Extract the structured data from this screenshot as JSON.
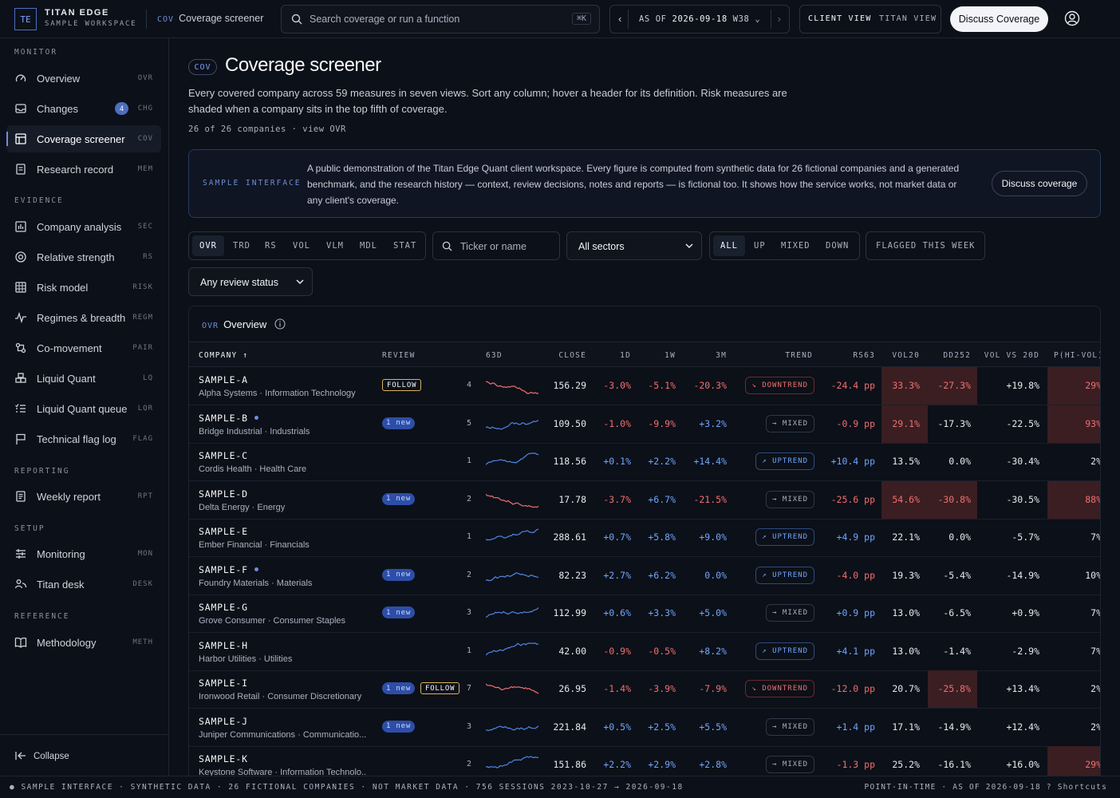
{
  "header": {
    "logo": "TE",
    "brand": "TITAN EDGE",
    "workspace": "SAMPLE WORKSPACE",
    "crumb_code": "COV",
    "crumb_label": "Coverage screener",
    "search_placeholder": "Search coverage or run a function",
    "search_shortcut": "⌘K",
    "asof_prefix": "AS OF",
    "asof_date": "2026-09-18",
    "asof_week": "W38",
    "view_client": "CLIENT VIEW",
    "view_titan": "TITAN VIEW",
    "cta": "Discuss Coverage"
  },
  "sidebar": {
    "sections": [
      {
        "title": "MONITOR",
        "items": [
          {
            "label": "Overview",
            "code": "OVR",
            "icon": "gauge-icon"
          },
          {
            "label": "Changes",
            "code": "CHG",
            "icon": "inbox-icon",
            "badge": "4"
          },
          {
            "label": "Coverage screener",
            "code": "COV",
            "icon": "table-icon",
            "active": true
          },
          {
            "label": "Research record",
            "code": "MEM",
            "icon": "document-icon"
          }
        ]
      },
      {
        "title": "EVIDENCE",
        "items": [
          {
            "label": "Company analysis",
            "code": "SEC",
            "icon": "bar-chart-icon"
          },
          {
            "label": "Relative strength",
            "code": "RS",
            "icon": "target-icon"
          },
          {
            "label": "Risk model",
            "code": "RISK",
            "icon": "grid-icon"
          },
          {
            "label": "Regimes & breadth",
            "code": "REGM",
            "icon": "pulse-icon"
          },
          {
            "label": "Co-movement",
            "code": "PAIR",
            "icon": "link-icon"
          },
          {
            "label": "Liquid Quant",
            "code": "LQ",
            "icon": "cubes-icon"
          },
          {
            "label": "Liquid Quant queue",
            "code": "LQR",
            "icon": "list-check-icon"
          },
          {
            "label": "Technical flag log",
            "code": "FLAG",
            "icon": "flag-icon"
          }
        ]
      },
      {
        "title": "REPORTING",
        "items": [
          {
            "label": "Weekly report",
            "code": "RPT",
            "icon": "report-icon"
          }
        ]
      },
      {
        "title": "SETUP",
        "items": [
          {
            "label": "Monitoring",
            "code": "MON",
            "icon": "sliders-icon"
          },
          {
            "label": "Titan desk",
            "code": "DESK",
            "icon": "users-icon"
          }
        ]
      },
      {
        "title": "REFERENCE",
        "items": [
          {
            "label": "Methodology",
            "code": "METH",
            "icon": "book-icon"
          }
        ]
      }
    ],
    "collapse": "Collapse"
  },
  "page": {
    "code": "COV",
    "title": "Coverage screener",
    "description": "Every covered company across 59 measures in seven views. Sort any column; hover a header for its definition. Risk measures are shaded when a company sits in the top fifth of coverage.",
    "count": "26 of 26 companies · view OVR"
  },
  "banner": {
    "label": "SAMPLE INTERFACE",
    "text": "A public demonstration of the Titan Edge Quant client workspace. Every figure is computed from synthetic data for 26 fictional companies and a generated benchmark, and the research history — context, review decisions, notes and reports — is fictional too. It shows how the service works, not market data or any client's coverage.",
    "button": "Discuss coverage"
  },
  "filters": {
    "views": [
      "OVR",
      "TRD",
      "RS",
      "VOL",
      "VLM",
      "MDL",
      "STAT"
    ],
    "ticker_placeholder": "Ticker or name",
    "sector": "All sectors",
    "trend_filters": [
      "ALL",
      "UP",
      "MIXED",
      "DOWN"
    ],
    "flagged": "FLAGGED THIS WEEK",
    "review": "Any review status"
  },
  "table": {
    "code": "OVR",
    "title": "Overview",
    "columns": [
      "COMPANY ↑",
      "REVIEW",
      "63D",
      "CLOSE",
      "1D",
      "1W",
      "3M",
      "TREND",
      "RS63",
      "VOL20",
      "DD252",
      "VOL VS 20D",
      "P(HI-VOL)"
    ],
    "rows": [
      {
        "ticker": "SAMPLE-A",
        "dot": false,
        "sub": "Alpha Systems · Information Technology",
        "follow": true,
        "new": "",
        "n": "4",
        "close": "156.29",
        "d1": "-3.0%",
        "w1": "-5.1%",
        "m3": "-20.3%",
        "trend": "DOWNTREND",
        "rs": "-24.4 pp",
        "vol20": "33.3%",
        "dd": "-27.3%",
        "volvs": "+19.8%",
        "phv": "29%",
        "hv": true,
        "hd": true,
        "hp": true
      },
      {
        "ticker": "SAMPLE-B",
        "dot": true,
        "sub": "Bridge Industrial · Industrials",
        "follow": false,
        "new": "1 new",
        "n": "5",
        "close": "109.50",
        "d1": "-1.0%",
        "w1": "-9.9%",
        "m3": "+3.2%",
        "trend": "MIXED",
        "rs": "-0.9 pp",
        "vol20": "29.1%",
        "dd": "-17.3%",
        "volvs": "-22.5%",
        "phv": "93%",
        "hv": true,
        "hd": false,
        "hp": true
      },
      {
        "ticker": "SAMPLE-C",
        "dot": false,
        "sub": "Cordis Health · Health Care",
        "follow": false,
        "new": "",
        "n": "1",
        "close": "118.56",
        "d1": "+0.1%",
        "w1": "+2.2%",
        "m3": "+14.4%",
        "trend": "UPTREND",
        "rs": "+10.4 pp",
        "vol20": "13.5%",
        "dd": "0.0%",
        "volvs": "-30.4%",
        "phv": "2%",
        "hv": false,
        "hd": false,
        "hp": false
      },
      {
        "ticker": "SAMPLE-D",
        "dot": false,
        "sub": "Delta Energy · Energy",
        "follow": false,
        "new": "1 new",
        "n": "2",
        "close": "17.78",
        "d1": "-3.7%",
        "w1": "+6.7%",
        "m3": "-21.5%",
        "trend": "MIXED",
        "rs": "-25.6 pp",
        "vol20": "54.6%",
        "dd": "-30.8%",
        "volvs": "-30.5%",
        "phv": "88%",
        "hv": true,
        "hd": true,
        "hp": true
      },
      {
        "ticker": "SAMPLE-E",
        "dot": false,
        "sub": "Ember Financial · Financials",
        "follow": false,
        "new": "",
        "n": "1",
        "close": "288.61",
        "d1": "+0.7%",
        "w1": "+5.8%",
        "m3": "+9.0%",
        "trend": "UPTREND",
        "rs": "+4.9 pp",
        "vol20": "22.1%",
        "dd": "0.0%",
        "volvs": "-5.7%",
        "phv": "7%",
        "hv": false,
        "hd": false,
        "hp": false
      },
      {
        "ticker": "SAMPLE-F",
        "dot": true,
        "sub": "Foundry Materials · Materials",
        "follow": false,
        "new": "1 new",
        "n": "2",
        "close": "82.23",
        "d1": "+2.7%",
        "w1": "+6.2%",
        "m3": "0.0%",
        "trend": "UPTREND",
        "rs": "-4.0 pp",
        "vol20": "19.3%",
        "dd": "-5.4%",
        "volvs": "-14.9%",
        "phv": "10%",
        "hv": false,
        "hd": false,
        "hp": false
      },
      {
        "ticker": "SAMPLE-G",
        "dot": false,
        "sub": "Grove Consumer · Consumer Staples",
        "follow": false,
        "new": "1 new",
        "n": "3",
        "close": "112.99",
        "d1": "+0.6%",
        "w1": "+3.3%",
        "m3": "+5.0%",
        "trend": "MIXED",
        "rs": "+0.9 pp",
        "vol20": "13.0%",
        "dd": "-6.5%",
        "volvs": "+0.9%",
        "phv": "7%",
        "hv": false,
        "hd": false,
        "hp": false
      },
      {
        "ticker": "SAMPLE-H",
        "dot": false,
        "sub": "Harbor Utilities · Utilities",
        "follow": false,
        "new": "",
        "n": "1",
        "close": "42.00",
        "d1": "-0.9%",
        "w1": "-0.5%",
        "m3": "+8.2%",
        "trend": "UPTREND",
        "rs": "+4.1 pp",
        "vol20": "13.0%",
        "dd": "-1.4%",
        "volvs": "-2.9%",
        "phv": "7%",
        "hv": false,
        "hd": false,
        "hp": false
      },
      {
        "ticker": "SAMPLE-I",
        "dot": false,
        "sub": "Ironwood Retail · Consumer Discretionary",
        "follow": true,
        "new": "1 new",
        "n": "7",
        "close": "26.95",
        "d1": "-1.4%",
        "w1": "-3.9%",
        "m3": "-7.9%",
        "trend": "DOWNTREND",
        "rs": "-12.0 pp",
        "vol20": "20.7%",
        "dd": "-25.8%",
        "volvs": "+13.4%",
        "phv": "2%",
        "hv": false,
        "hd": true,
        "hp": false
      },
      {
        "ticker": "SAMPLE-J",
        "dot": false,
        "sub": "Juniper Communications · Communicatio...",
        "follow": false,
        "new": "1 new",
        "n": "3",
        "close": "221.84",
        "d1": "+0.5%",
        "w1": "+2.5%",
        "m3": "+5.5%",
        "trend": "MIXED",
        "rs": "+1.4 pp",
        "vol20": "17.1%",
        "dd": "-14.9%",
        "volvs": "+12.4%",
        "phv": "2%",
        "hv": false,
        "hd": false,
        "hp": false
      },
      {
        "ticker": "SAMPLE-K",
        "dot": false,
        "sub": "Keystone Software · Information Technolo...",
        "follow": false,
        "new": "",
        "n": "2",
        "close": "151.86",
        "d1": "+2.2%",
        "w1": "+2.9%",
        "m3": "+2.8%",
        "trend": "MIXED",
        "rs": "-1.3 pp",
        "vol20": "25.2%",
        "dd": "-16.1%",
        "volvs": "+16.0%",
        "phv": "29%",
        "hv": false,
        "hd": false,
        "hp": true
      }
    ]
  },
  "footer": {
    "left": "● SAMPLE INTERFACE · SYNTHETIC DATA · 26 FICTIONAL COMPANIES · NOT MARKET DATA · 756 SESSIONS 2023-10-27 → 2026-09-18",
    "right": "POINT-IN-TIME · AS OF 2026-09-18   ? Shortcuts"
  },
  "colors": {
    "accent": "#6f8ed8",
    "negative": "#f06f6f",
    "positive": "#6fa5ff",
    "risk_shade": "#3a1e22",
    "follow": "#d9b45e"
  }
}
